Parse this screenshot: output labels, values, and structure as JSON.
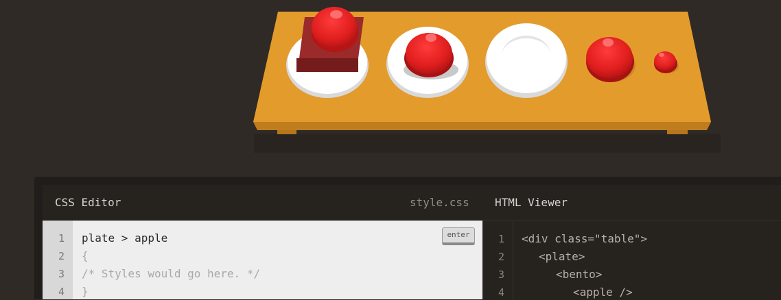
{
  "css_editor": {
    "title": "CSS Editor",
    "filename": "style.css",
    "enter_label": "enter",
    "lines": [
      {
        "number": "1",
        "text": "plate > apple"
      },
      {
        "number": "2",
        "text": "{"
      },
      {
        "number": "3",
        "text": "/* Styles would go here. */"
      },
      {
        "number": "4",
        "text": "}"
      }
    ]
  },
  "html_viewer": {
    "title": "HTML Viewer",
    "lines": [
      {
        "number": "1",
        "text": "<div class=\"table\">"
      },
      {
        "number": "2",
        "text": "<plate>"
      },
      {
        "number": "3",
        "text": "<bento>"
      },
      {
        "number": "4",
        "text": "<apple />"
      }
    ]
  },
  "colors": {
    "table_top": "#e09a2b",
    "table_edge": "#b8761c",
    "apple": "#e01e1e",
    "plate": "#ffffff",
    "bento": "#8b2020"
  }
}
